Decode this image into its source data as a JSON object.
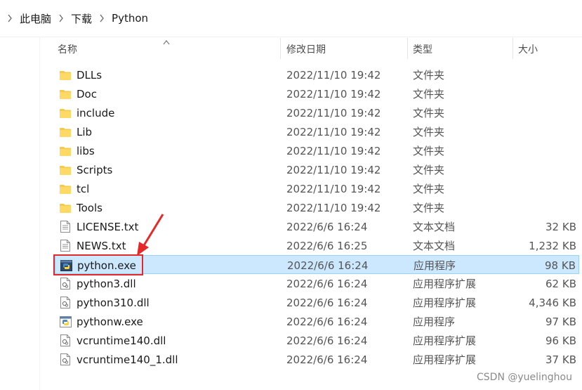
{
  "breadcrumb": {
    "items": [
      "此电脑",
      "下载",
      "Python"
    ]
  },
  "columns": {
    "name": "名称",
    "date": "修改日期",
    "type": "类型",
    "size": "大小"
  },
  "files": [
    {
      "name": "DLLs",
      "date": "2022/11/10 19:42",
      "type": "文件夹",
      "size": "",
      "icon": "folder-icon"
    },
    {
      "name": "Doc",
      "date": "2022/11/10 19:42",
      "type": "文件夹",
      "size": "",
      "icon": "folder-icon"
    },
    {
      "name": "include",
      "date": "2022/11/10 19:42",
      "type": "文件夹",
      "size": "",
      "icon": "folder-icon"
    },
    {
      "name": "Lib",
      "date": "2022/11/10 19:42",
      "type": "文件夹",
      "size": "",
      "icon": "folder-icon"
    },
    {
      "name": "libs",
      "date": "2022/11/10 19:42",
      "type": "文件夹",
      "size": "",
      "icon": "folder-icon"
    },
    {
      "name": "Scripts",
      "date": "2022/11/10 19:42",
      "type": "文件夹",
      "size": "",
      "icon": "folder-icon"
    },
    {
      "name": "tcl",
      "date": "2022/11/10 19:42",
      "type": "文件夹",
      "size": "",
      "icon": "folder-icon"
    },
    {
      "name": "Tools",
      "date": "2022/11/10 19:42",
      "type": "文件夹",
      "size": "",
      "icon": "folder-icon"
    },
    {
      "name": "LICENSE.txt",
      "date": "2022/6/6 16:24",
      "type": "文本文档",
      "size": "32 KB",
      "icon": "text-file-icon"
    },
    {
      "name": "NEWS.txt",
      "date": "2022/6/6 16:25",
      "type": "文本文档",
      "size": "1,232 KB",
      "icon": "text-file-icon"
    },
    {
      "name": "python.exe",
      "date": "2022/6/6 16:24",
      "type": "应用程序",
      "size": "98 KB",
      "icon": "python-app-icon",
      "selected": true
    },
    {
      "name": "python3.dll",
      "date": "2022/6/6 16:24",
      "type": "应用程序扩展",
      "size": "62 KB",
      "icon": "dll-file-icon"
    },
    {
      "name": "python310.dll",
      "date": "2022/6/6 16:24",
      "type": "应用程序扩展",
      "size": "4,346 KB",
      "icon": "dll-file-icon"
    },
    {
      "name": "pythonw.exe",
      "date": "2022/6/6 16:24",
      "type": "应用程序",
      "size": "97 KB",
      "icon": "pythonw-app-icon"
    },
    {
      "name": "vcruntime140.dll",
      "date": "2022/6/6 16:24",
      "type": "应用程序扩展",
      "size": "96 KB",
      "icon": "dll-file-icon"
    },
    {
      "name": "vcruntime140_1.dll",
      "date": "2022/6/6 16:24",
      "type": "应用程序扩展",
      "size": "37 KB",
      "icon": "dll-file-icon"
    }
  ],
  "watermark": "CSDN @yuelinghou",
  "colors": {
    "selection_bg": "#cce8ff",
    "selection_border": "#99d1ff",
    "annotation_red": "#e62828",
    "folder_yellow": "#f7c948"
  }
}
